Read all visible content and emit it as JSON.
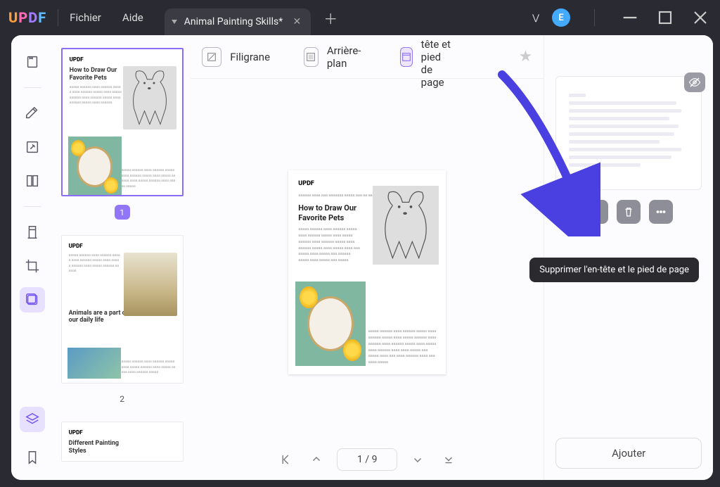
{
  "titlebar": {
    "menus": {
      "file": "Fichier",
      "help": "Aide"
    },
    "tab": {
      "title": "Animal Painting Skills*"
    },
    "avatar_initial": "E"
  },
  "top_tools": {
    "watermark": "Filigrane",
    "background": "Arrière-plan",
    "header_footer": "En-tête et pied de page"
  },
  "document": {
    "article_title": "How to Draw Our Favorite Pets",
    "article2_title": "Animals are a part of our daily life",
    "article3_title": "Different Painting Styles"
  },
  "nav": {
    "page_display": "1 / 9"
  },
  "thumbnails": {
    "p1": "1",
    "p2": "2"
  },
  "right_panel": {
    "tooltip": "Supprimer l'en-tête et le pied de page",
    "add_button": "Ajouter"
  }
}
